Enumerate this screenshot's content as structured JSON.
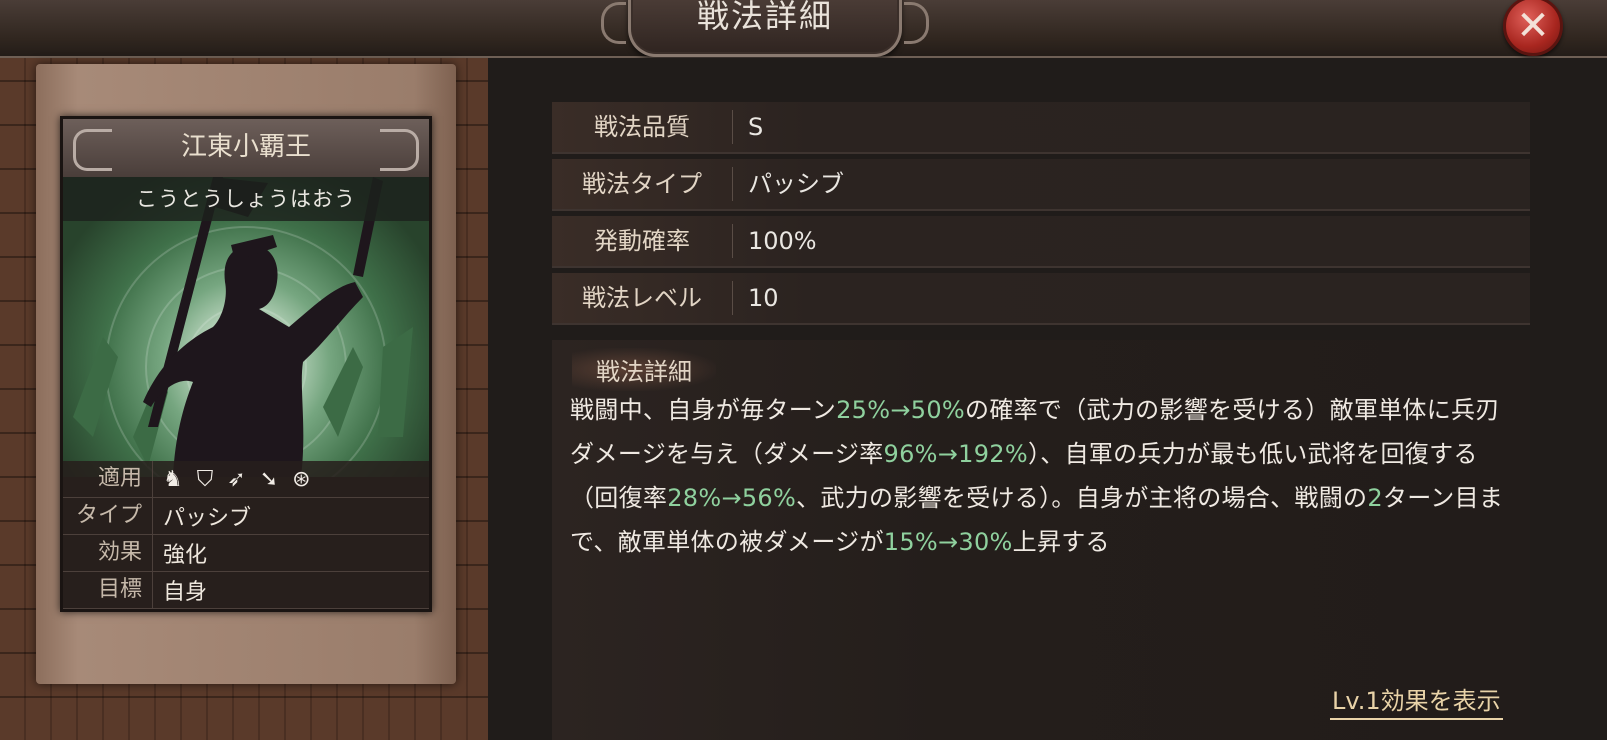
{
  "header": {
    "title": "戦法詳細",
    "close_icon": "close-icon"
  },
  "card": {
    "name": "江東小覇王",
    "reading": "こうとうしょうはおう",
    "applicable_label": "適用",
    "applicable_icons": [
      "cavalry-icon",
      "shield-icon",
      "bow-icon",
      "spear-icon",
      "wheel-icon"
    ],
    "type_label": "タイプ",
    "type_value": "パッシブ",
    "effect_label": "効果",
    "effect_value": "強化",
    "target_label": "目標",
    "target_value": "自身"
  },
  "info": {
    "quality_label": "戦法品質",
    "quality_value": "S",
    "type_label": "戦法タイプ",
    "type_value": "パッシブ",
    "rate_label": "発動確率",
    "rate_value": "100%",
    "level_label": "戦法レベル",
    "level_value": "10"
  },
  "detail": {
    "label": "戦法詳細",
    "text_parts": [
      {
        "t": "戦闘中、自身が毎ターン",
        "hl": false
      },
      {
        "t": "25%→50%",
        "hl": true
      },
      {
        "t": "の確率で（武力の影響を受ける）敵軍単体に兵刃ダメージを与え（ダメージ率",
        "hl": false
      },
      {
        "t": "96%→192%",
        "hl": true
      },
      {
        "t": "）、自軍の兵力が最も低い武将を回復する（回復率",
        "hl": false
      },
      {
        "t": "28%→56%",
        "hl": true
      },
      {
        "t": "、武力の影響を受ける）。自身が主将の場合、戦闘の",
        "hl": false
      },
      {
        "t": "2",
        "hl": true
      },
      {
        "t": "ターン目まで、敵軍単体の被ダメージが",
        "hl": false
      },
      {
        "t": "15%→30%",
        "hl": true
      },
      {
        "t": "上昇する",
        "hl": false
      }
    ],
    "highlight_color": "#8fd19e"
  },
  "footer": {
    "lv1_link": "Lv.1効果を表示"
  }
}
